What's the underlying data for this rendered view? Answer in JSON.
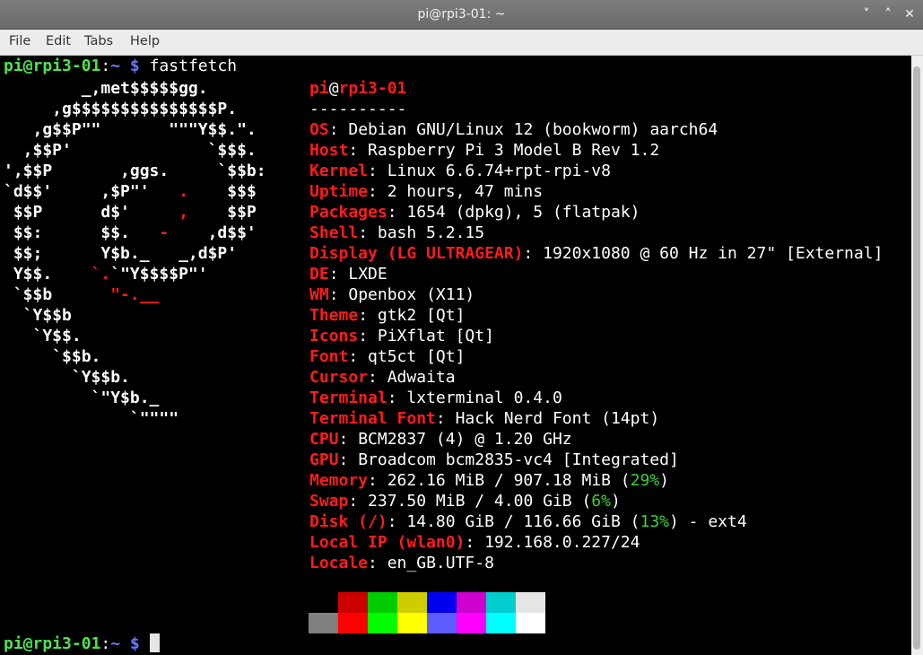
{
  "window": {
    "title": "pi@rpi3-01: ~",
    "controls": [
      "˅",
      "˄",
      "✕"
    ]
  },
  "menu": [
    "File",
    "Edit",
    "Tabs",
    "Help"
  ],
  "prompt": {
    "user": "pi@rpi3-01",
    "sep": ":",
    "path": "~",
    "symbol": "$",
    "command": "fastfetch"
  },
  "logo_lines": [
    [
      {
        "t": "        _,met$$$$$gg.",
        "c": "d"
      }
    ],
    [
      {
        "t": "     ,g$$$$$$$$$$$$$$$P.",
        "c": "d"
      }
    ],
    [
      {
        "t": "   ,g$$P\"\"       \"\"\"Y$$.\".",
        "c": "d"
      }
    ],
    [
      {
        "t": "  ,$$P'              `$$$.",
        "c": "d"
      }
    ],
    [
      {
        "t": "',$$P       ,ggs.     `$$b:",
        "c": "d"
      }
    ],
    [
      {
        "t": "`d$$'     ,$P\"'   ",
        "c": "d"
      },
      {
        "t": ".",
        "c": "r"
      },
      {
        "t": "    $$$",
        "c": "d"
      }
    ],
    [
      {
        "t": " $$P      d$'     ",
        "c": "d"
      },
      {
        "t": ",",
        "c": "r"
      },
      {
        "t": "    $$P",
        "c": "d"
      }
    ],
    [
      {
        "t": " $$:      $$.   ",
        "c": "d"
      },
      {
        "t": "-",
        "c": "r"
      },
      {
        "t": "    ,d$$'",
        "c": "d"
      }
    ],
    [
      {
        "t": " $$;      Y$b._   _,d$P'",
        "c": "d"
      }
    ],
    [
      {
        "t": " Y$$.    ",
        "c": "d"
      },
      {
        "t": "`.",
        "c": "r"
      },
      {
        "t": "`\"Y$$$$P\"'",
        "c": "d"
      }
    ],
    [
      {
        "t": " `$$b      ",
        "c": "d"
      },
      {
        "t": "\"-.__",
        "c": "r"
      }
    ],
    [
      {
        "t": "  `Y$$b",
        "c": "d"
      }
    ],
    [
      {
        "t": "   `Y$$.",
        "c": "d"
      }
    ],
    [
      {
        "t": "     `$$b.",
        "c": "d"
      }
    ],
    [
      {
        "t": "       `Y$$b.",
        "c": "d"
      }
    ],
    [
      {
        "t": "         `\"Y$b._",
        "c": "d"
      }
    ],
    [
      {
        "t": "             `\"\"\"\"",
        "c": "d"
      }
    ]
  ],
  "info": {
    "header_user": "pi",
    "header_at": "@",
    "header_host": "rpi3-01",
    "separator": "----------",
    "rows": [
      {
        "k": "OS",
        "v": "Debian GNU/Linux 12 (bookworm) aarch64"
      },
      {
        "k": "Host",
        "v": "Raspberry Pi 3 Model B Rev 1.2"
      },
      {
        "k": "Kernel",
        "v": "Linux 6.6.74+rpt-rpi-v8"
      },
      {
        "k": "Uptime",
        "v": "2 hours, 47 mins"
      },
      {
        "k": "Packages",
        "v": "1654 (dpkg), 5 (flatpak)"
      },
      {
        "k": "Shell",
        "v": "bash 5.2.15"
      },
      {
        "k": "Display (LG ULTRAGEAR)",
        "v": "1920x1080 @ 60 Hz in 27\" [External]"
      },
      {
        "k": "DE",
        "v": "LXDE"
      },
      {
        "k": "WM",
        "v": "Openbox (X11)"
      },
      {
        "k": "Theme",
        "v": "gtk2 [Qt]"
      },
      {
        "k": "Icons",
        "v": "PiXflat [Qt]"
      },
      {
        "k": "Font",
        "v": "qt5ct [Qt]"
      },
      {
        "k": "Cursor",
        "v": "Adwaita"
      },
      {
        "k": "Terminal",
        "v": "lxterminal 0.4.0"
      },
      {
        "k": "Terminal Font",
        "v": "Hack Nerd Font (14pt)"
      },
      {
        "k": "CPU",
        "v": "BCM2837 (4) @ 1.20 GHz"
      },
      {
        "k": "GPU",
        "v": "Broadcom bcm2835-vc4 [Integrated]"
      },
      {
        "k": "Memory",
        "v": "262.16 MiB / 907.18 MiB (",
        "pct": "29%",
        "tail": ")"
      },
      {
        "k": "Swap",
        "v": "237.50 MiB / 4.00 GiB (",
        "pct": "6%",
        "tail": ")"
      },
      {
        "k": "Disk (/)",
        "v": "14.80 GiB / 116.66 GiB (",
        "pct": "13%",
        "tail": ") - ext4"
      },
      {
        "k": "Local IP (wlan0)",
        "v": "192.168.0.227/24"
      },
      {
        "k": "Locale",
        "v": "en_GB.UTF-8"
      }
    ]
  },
  "palette": {
    "top": [
      "#000000",
      "#cd0000",
      "#00cd00",
      "#cdcd00",
      "#0000ee",
      "#cd00cd",
      "#00cdcd",
      "#e5e5e5"
    ],
    "bottom": [
      "#7f7f7f",
      "#ff0000",
      "#00ff00",
      "#ffff00",
      "#5c5cff",
      "#ff00ff",
      "#00ffff",
      "#ffffff"
    ]
  }
}
